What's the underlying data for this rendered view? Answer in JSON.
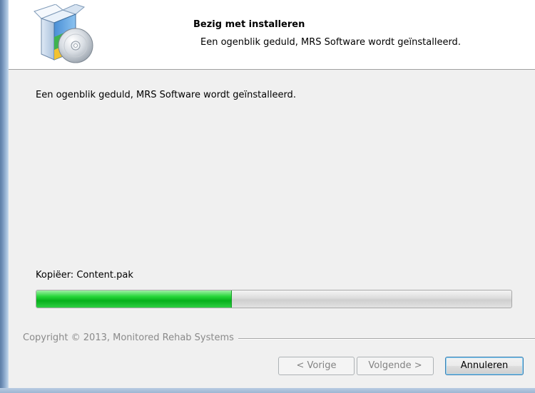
{
  "header": {
    "title": "Bezig met installeren",
    "subtitle": "Een ogenblik geduld, MRS Software wordt geïnstalleerd.",
    "icon": "installer-package-cd-icon"
  },
  "main": {
    "status_text": "Een ogenblik geduld, MRS Software wordt geïnstalleerd.",
    "current_action": "Kopiëer: Content.pak",
    "progress": 0.41
  },
  "footer": {
    "copyright": "Copyright © 2013, Monitored Rehab Systems",
    "back_label": "< Vorige",
    "next_label": "Volgende >",
    "cancel_label": "Annuleren"
  },
  "colors": {
    "progress_fill": "#06b01b",
    "window_edge": "#6f8fb7"
  }
}
